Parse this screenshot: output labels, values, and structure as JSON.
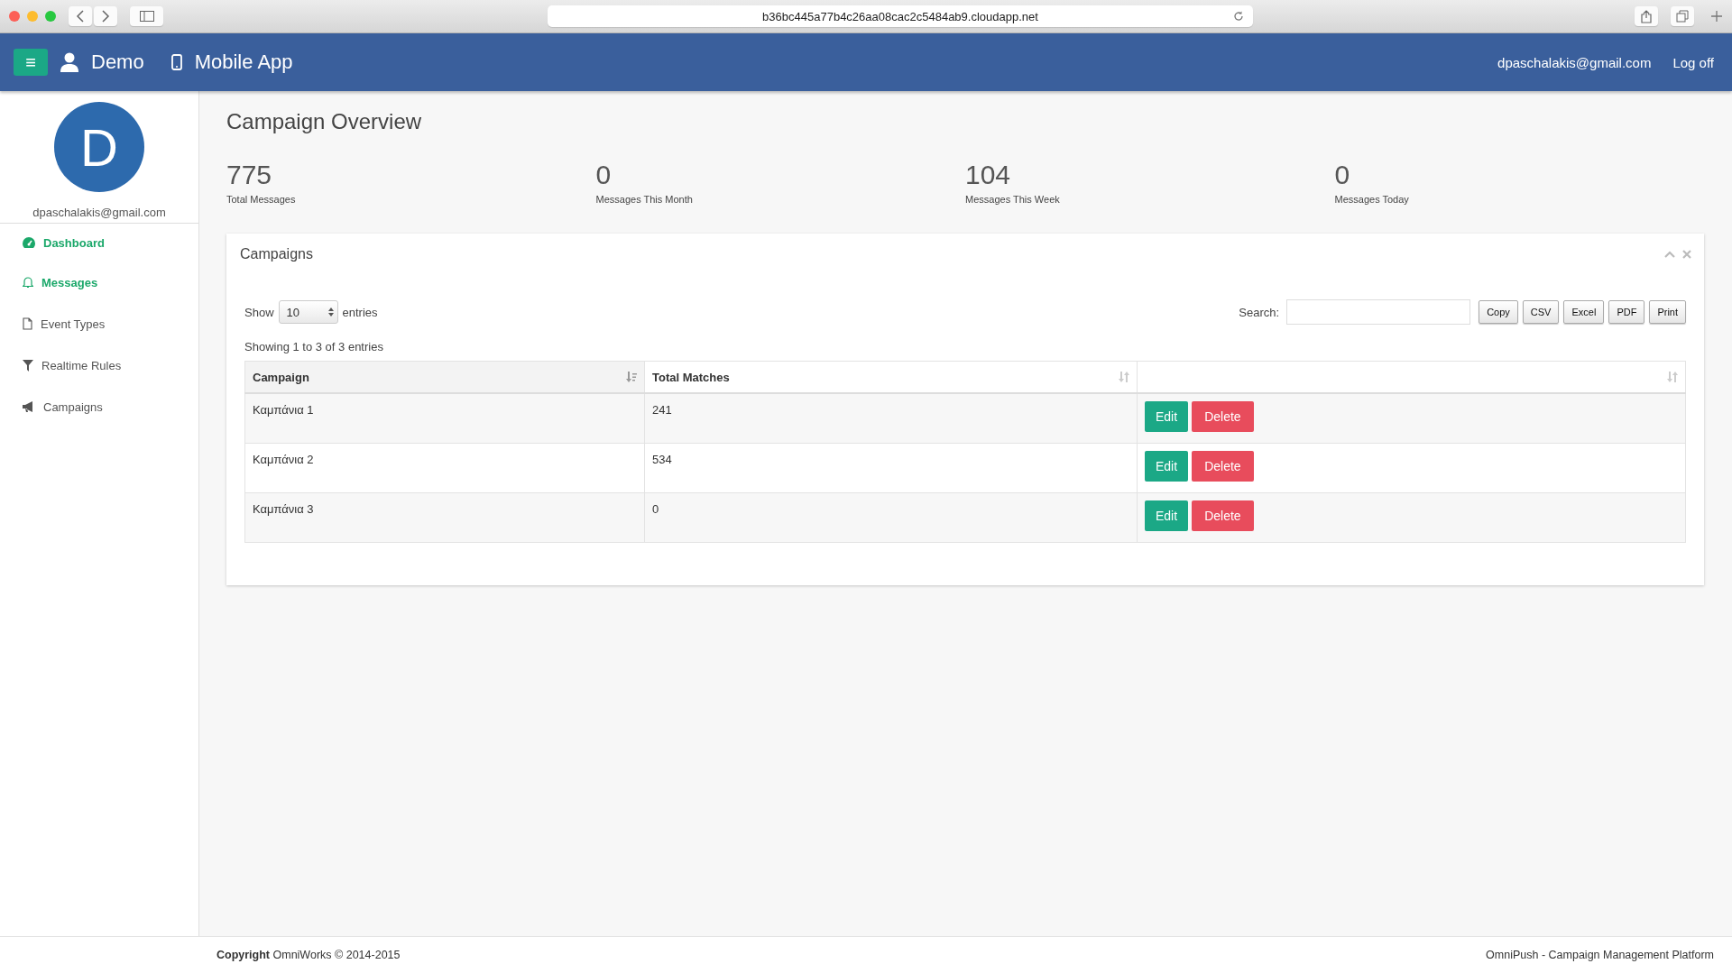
{
  "browser": {
    "url": "b36bc445a77b4c26aa08cac2c5484ab9.cloudapp.net"
  },
  "header": {
    "menu_icon": "≡",
    "account": "Demo",
    "app": "Mobile App",
    "user_email": "dpaschalakis@gmail.com",
    "logoff": "Log off"
  },
  "sidebar": {
    "avatar_letter": "D",
    "email": "dpaschalakis@gmail.com",
    "items": [
      {
        "label": "Dashboard",
        "selected": true
      },
      {
        "label": "Messages",
        "selected": true
      },
      {
        "label": "Event Types",
        "selected": false
      },
      {
        "label": "Realtime Rules",
        "selected": false
      },
      {
        "label": "Campaigns",
        "selected": false
      }
    ]
  },
  "page_title": "Campaign Overview",
  "stats": [
    {
      "value": "775",
      "label": "Total Messages"
    },
    {
      "value": "0",
      "label": "Messages This Month"
    },
    {
      "value": "104",
      "label": "Messages This Week"
    },
    {
      "value": "0",
      "label": "Messages Today"
    }
  ],
  "panel": {
    "title": "Campaigns",
    "show_label": "Show",
    "page_size": "10",
    "entries_label": "entries",
    "search_label": "Search:",
    "export_buttons": [
      "Copy",
      "CSV",
      "Excel",
      "PDF",
      "Print"
    ],
    "info": "Showing 1 to 3 of 3 entries",
    "table": {
      "columns": [
        {
          "label": "Campaign",
          "sorted": true
        },
        {
          "label": "Total Matches",
          "sorted": false
        },
        {
          "sorted": false
        }
      ],
      "rows": [
        {
          "campaign": "Καμπάνια 1",
          "total_matches": "241",
          "actions": [
            "Edit",
            "Delete"
          ]
        },
        {
          "campaign": "Καμπάνια 2",
          "total_matches": "534",
          "actions": [
            "Edit",
            "Delete"
          ]
        },
        {
          "campaign": "Καμπάνια 3",
          "total_matches": "0",
          "actions": [
            "Edit",
            "Delete"
          ]
        }
      ]
    }
  },
  "footer": {
    "copyright": "**Copyright** OmniWorks © 2014-2015",
    "platform": "OmniPush - Campaign Management Platform"
  }
}
